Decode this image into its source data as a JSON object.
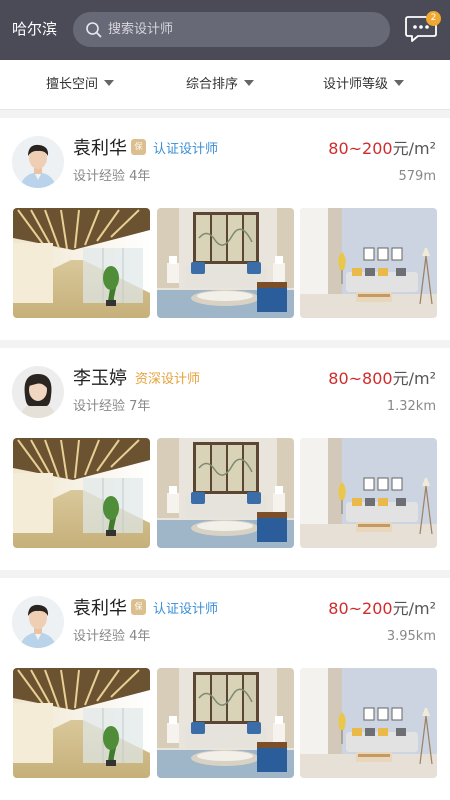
{
  "header": {
    "city": "哈尔滨",
    "search_placeholder": "搜索设计师",
    "message_badge": "2"
  },
  "filters": [
    {
      "label": "擅长空间"
    },
    {
      "label": "综合排序"
    },
    {
      "label": "设计师等级"
    }
  ],
  "designers": [
    {
      "name": "袁利华",
      "badge": "保",
      "title": "认证设计师",
      "title_color": "#3a8ed6",
      "price": "80~200",
      "price_unit": "元/m²",
      "experience": "设计经验 4年",
      "distance": "579m",
      "photos": [
        "corridor-photo",
        "living-room-photo",
        "sofa-room-photo"
      ]
    },
    {
      "name": "李玉婷",
      "badge": "",
      "title": "资深设计师",
      "title_color": "#e5a23b",
      "price": "80~800",
      "price_unit": "元/m²",
      "experience": "设计经验 7年",
      "distance": "1.32km",
      "photos": [
        "corridor-photo",
        "living-room-photo",
        "sofa-room-photo"
      ]
    },
    {
      "name": "袁利华",
      "badge": "保",
      "title": "认证设计师",
      "title_color": "#3a8ed6",
      "price": "80~200",
      "price_unit": "元/m²",
      "experience": "设计经验 4年",
      "distance": "3.95km",
      "photos": [
        "corridor-photo",
        "living-room-photo",
        "sofa-room-photo"
      ]
    }
  ]
}
